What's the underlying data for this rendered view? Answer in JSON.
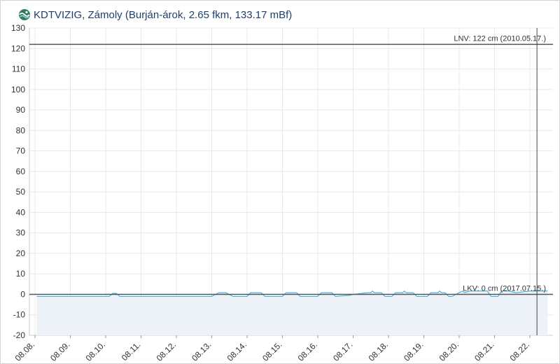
{
  "header": {
    "title": "KDTVIZIG, Zámoly (Burján-árok, 2.65 fkm, 133.17 mBf)",
    "icon": "water-gauge-icon"
  },
  "colors": {
    "series": "#29a8d6",
    "area": "#edf1f8",
    "reference_line": "#555555",
    "grid": "#e8e8e8",
    "title": "#1f3f6b"
  },
  "chart_data": {
    "type": "area",
    "title": "",
    "xlabel": "",
    "ylabel": "",
    "ylim": [
      -20,
      130
    ],
    "yticks": [
      -20,
      -10,
      0,
      10,
      20,
      30,
      40,
      50,
      60,
      70,
      80,
      90,
      100,
      110,
      120,
      130
    ],
    "xlim": [
      0,
      14.5
    ],
    "grid": true,
    "x_ticks": [
      {
        "x": 0,
        "label": "08.08."
      },
      {
        "x": 1,
        "label": "08.09."
      },
      {
        "x": 2,
        "label": "08.10."
      },
      {
        "x": 3,
        "label": "08.11."
      },
      {
        "x": 4,
        "label": "08.12."
      },
      {
        "x": 5,
        "label": "08.13."
      },
      {
        "x": 6,
        "label": "08.14."
      },
      {
        "x": 7,
        "label": "08.15."
      },
      {
        "x": 8,
        "label": "08.16."
      },
      {
        "x": 9,
        "label": "08.17."
      },
      {
        "x": 10,
        "label": "08.18."
      },
      {
        "x": 11,
        "label": "08.19."
      },
      {
        "x": 12,
        "label": "08.20."
      },
      {
        "x": 13,
        "label": "08.21."
      },
      {
        "x": 14,
        "label": "08.22."
      }
    ],
    "series": [
      {
        "x": [
          0.05,
          2.1,
          2.2,
          2.3,
          2.4,
          5.0,
          5.2,
          5.4,
          5.6,
          6.0,
          6.1,
          6.4,
          6.5,
          7.0,
          7.1,
          7.4,
          7.5,
          8.0,
          8.1,
          8.4,
          8.5,
          8.9,
          9.0,
          9.4,
          9.5,
          9.55,
          9.6,
          9.8,
          9.9,
          10.1,
          10.2,
          10.4,
          10.45,
          10.5,
          10.6,
          10.7,
          10.8,
          11.1,
          11.2,
          11.4,
          11.45,
          11.5,
          11.6,
          11.7,
          11.8,
          12.0,
          12.1,
          12.15,
          12.3,
          12.8,
          12.9,
          13.1,
          13.2,
          13.4,
          13.6,
          14.0,
          14.2,
          14.5
        ],
        "values": [
          -1,
          -1,
          0.5,
          0.5,
          -1,
          -1,
          0.8,
          0.8,
          -1,
          -1,
          0.8,
          0.8,
          -1,
          -1,
          0.8,
          0.8,
          -1,
          -1,
          0.8,
          0.8,
          -1,
          -0.5,
          0,
          0.8,
          0.8,
          1.6,
          0.8,
          0.8,
          -1,
          -1,
          0.8,
          0.8,
          1.6,
          0.8,
          0.8,
          0.8,
          -1,
          -1,
          0.8,
          0.8,
          1.6,
          0.8,
          0.8,
          -1,
          -1,
          0.8,
          1.6,
          0.8,
          1.6,
          1.6,
          -1,
          -1,
          1.6,
          1.6,
          0.8,
          1.6,
          1.6,
          1.6
        ]
      }
    ],
    "reference_lines": [
      {
        "value": 122,
        "label": "LNV: 122 cm (2010.05.17.)"
      },
      {
        "value": 0,
        "label": "LKV: 0 cm (2017.07.15.)"
      }
    ],
    "vertical_marker": {
      "x": 14.2
    }
  }
}
